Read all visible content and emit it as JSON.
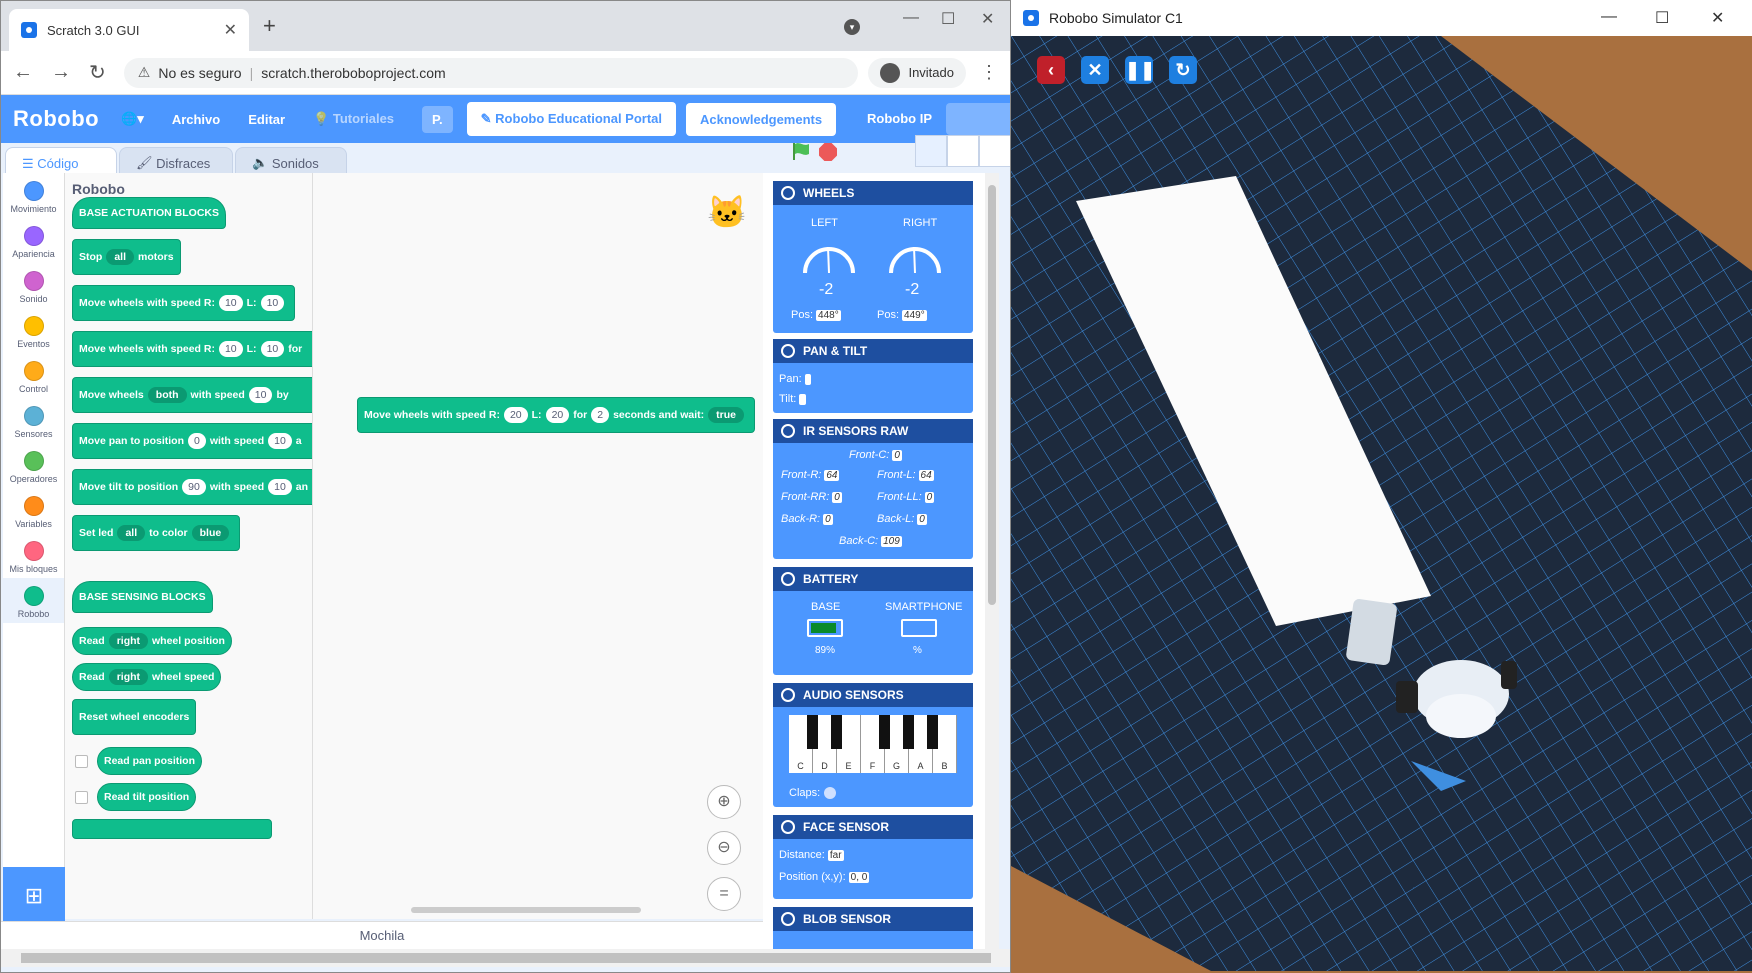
{
  "browser": {
    "tab_title": "Scratch 3.0 GUI",
    "security": "No es seguro",
    "url": "scratch.theroboboproject.com",
    "profile": "Invitado"
  },
  "menu": {
    "logo": "Robobo",
    "file": "Archivo",
    "edit": "Editar",
    "tutorials": "Tutoriales",
    "p": "P.",
    "portal": "Robobo Educational Portal",
    "ack": "Acknowledgements",
    "ip": "Robobo IP"
  },
  "tabs": {
    "code": "Código",
    "costumes": "Disfraces",
    "sounds": "Sonidos"
  },
  "categories": [
    {
      "label": "Movimiento",
      "color": "#4c97ff"
    },
    {
      "label": "Apariencia",
      "color": "#9966ff"
    },
    {
      "label": "Sonido",
      "color": "#cf63cf"
    },
    {
      "label": "Eventos",
      "color": "#ffbf00"
    },
    {
      "label": "Control",
      "color": "#ffab19"
    },
    {
      "label": "Sensores",
      "color": "#5cb1d6"
    },
    {
      "label": "Operadores",
      "color": "#59c059"
    },
    {
      "label": "Variables",
      "color": "#ff8c1a"
    },
    {
      "label": "Mis bloques",
      "color": "#ff6680"
    },
    {
      "label": "Robobo",
      "color": "#0fbd8c"
    }
  ],
  "palette": {
    "title": "Robobo",
    "base_actuation": "BASE ACTUATION BLOCKS",
    "stop": {
      "a": "Stop",
      "dd": "all",
      "b": "motors"
    },
    "move1": {
      "a": "Move wheels with speed R:",
      "r": "10",
      "l_lbl": "L:",
      "l": "10"
    },
    "move2": {
      "a": "Move wheels with speed R:",
      "r": "10",
      "l_lbl": "L:",
      "l": "10",
      "b": "for"
    },
    "move3": {
      "a": "Move wheels",
      "dd": "both",
      "b": "with speed",
      "v": "10",
      "c": "by"
    },
    "pan": {
      "a": "Move pan to position",
      "v": "0",
      "b": "with speed",
      "s": "10",
      "c": "a"
    },
    "tilt": {
      "a": "Move tilt to position",
      "v": "90",
      "b": "with speed",
      "s": "10",
      "c": "an"
    },
    "led": {
      "a": "Set led",
      "dd": "all",
      "b": "to color",
      "col": "blue"
    },
    "base_sensing": "BASE SENSING BLOCKS",
    "readpos": {
      "a": "Read",
      "dd": "right",
      "b": "wheel position"
    },
    "readspeed": {
      "a": "Read",
      "dd": "right",
      "b": "wheel speed"
    },
    "reset": "Reset wheel encoders",
    "readpan": "Read pan position",
    "readtilt": "Read tilt position"
  },
  "workspace": {
    "block": {
      "a": "Move wheels with speed R:",
      "r": "20",
      "l_lbl": "L:",
      "l": "20",
      "b": "for",
      "t": "2",
      "c": "seconds and wait:",
      "dd": "true"
    }
  },
  "mochila": "Mochila",
  "sensors": {
    "wheels": {
      "title": "WHEELS",
      "left": "LEFT",
      "right": "RIGHT",
      "lval": "-2",
      "rval": "-2",
      "pos": "Pos:",
      "lpos": "448°",
      "rpos": "449°"
    },
    "pantilt": {
      "title": "PAN & TILT",
      "pan": "Pan:",
      "tilt": "Tilt:"
    },
    "ir": {
      "title": "IR SENSORS RAW",
      "frontc": "Front-C:",
      "frontc_v": "0",
      "frontr": "Front-R:",
      "frontr_v": "64",
      "frontl": "Front-L:",
      "frontl_v": "64",
      "frontrr": "Front-RR:",
      "frontrr_v": "0",
      "frontll": "Front-LL:",
      "frontll_v": "0",
      "backr": "Back-R:",
      "backr_v": "0",
      "backl": "Back-L:",
      "backl_v": "0",
      "backc": "Back-C:",
      "backc_v": "109"
    },
    "battery": {
      "title": "BATTERY",
      "base": "BASE",
      "phone": "SMARTPHONE",
      "base_v": "89%",
      "phone_v": "%",
      "base_level": 0.89
    },
    "audio": {
      "title": "AUDIO SENSORS",
      "keys": [
        "C",
        "D",
        "E",
        "F",
        "G",
        "A",
        "B"
      ],
      "claps": "Claps:"
    },
    "face": {
      "title": "FACE SENSOR",
      "dist": "Distance:",
      "dist_v": "far",
      "pos": "Position (x,y):",
      "pos_v": "0, 0"
    },
    "blob": {
      "title": "BLOB SENSOR"
    }
  },
  "sim": {
    "title": "Robobo Simulator C1"
  },
  "colors": {
    "scratch_blue": "#4c97ff",
    "robobo_green": "#0fbd8c",
    "header_dark": "#1e4fa0"
  }
}
